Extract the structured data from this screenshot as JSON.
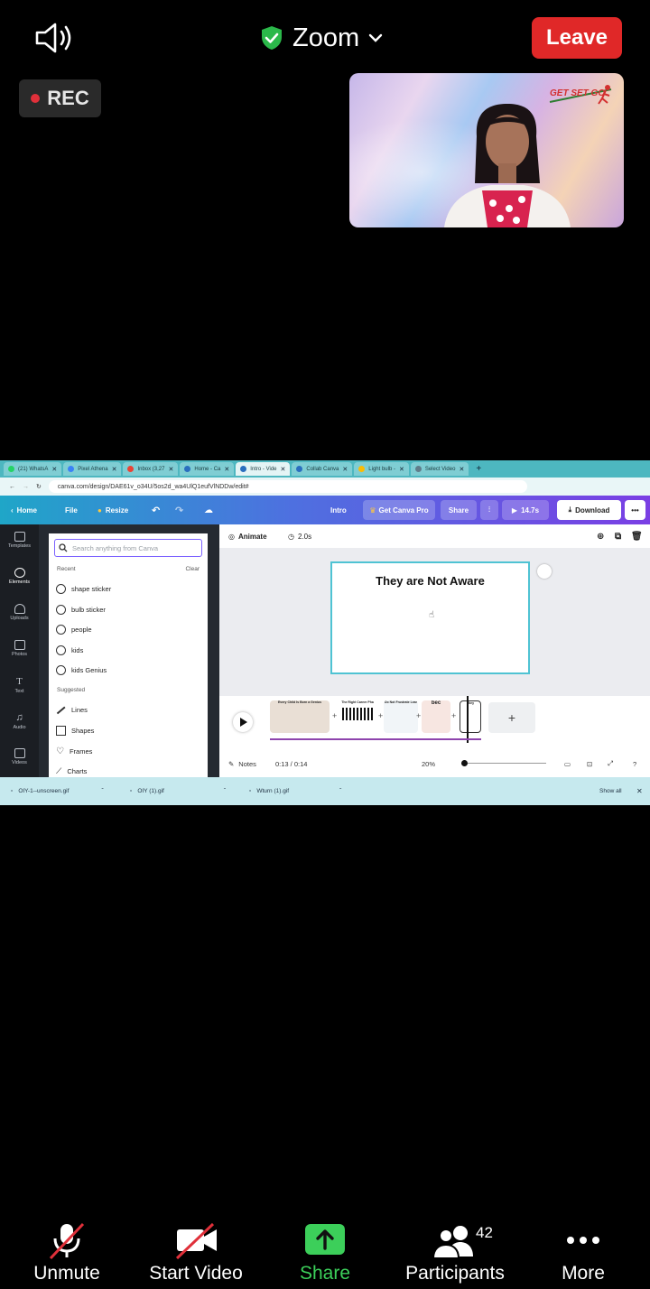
{
  "topbar": {
    "title": "Zoom",
    "leave_label": "Leave",
    "rec_label": "REC",
    "accent_leave": "#e02828",
    "shield_color": "#2bb84a"
  },
  "participant_video": {
    "logo_text": "GET SET GO"
  },
  "shared_screen": {
    "browser_tabs": [
      "(21) WhatsA",
      "Pixel Athena",
      "Inbox (3,27",
      "Home - Ca",
      "Intro - Vide",
      "Collab Canva",
      "Light bulb -",
      "Select Video"
    ],
    "url": "canva.com/design/DAE61v_o34U/5os2d_wa4UlQ1eufVlNDDw/edit#",
    "canva_bar": {
      "home": "Home",
      "file": "File",
      "resize": "Resize",
      "project_name": "Intro",
      "get_pro": "Get Canva Pro",
      "share": "Share",
      "duration": "14.7s",
      "download": "Download"
    },
    "left_rail": [
      "Templates",
      "Elements",
      "Uploads",
      "Photos",
      "Text",
      "Audio",
      "Videos"
    ],
    "panel": {
      "search_placeholder": "Search anything from Canva",
      "recent_label": "Recent",
      "clear_label": "Clear",
      "recent_items": [
        "shape sticker",
        "bulb sticker",
        "people",
        "kids",
        "kids Genius"
      ],
      "suggested_label": "Suggested",
      "suggested_items": [
        "Lines",
        "Shapes",
        "Frames",
        "Charts"
      ]
    },
    "editor": {
      "animate_label": "Animate",
      "slide_duration": "2.0s",
      "slide_heading": "They are Not Aware",
      "clip_titles": [
        "Every Child Is Born a Genius",
        "The Right Career Pha",
        "Do Not Frustrate Lear",
        "bec",
        "They"
      ],
      "notes_label": "Notes",
      "time": "0:13 / 0:14",
      "zoom": "20%"
    },
    "downloads": {
      "files": [
        "OIY-1--unscreen.gif",
        "OIY (1).gif",
        "Wturn (1).gif"
      ],
      "show_all": "Show all"
    }
  },
  "toolbar": {
    "unmute": "Unmute",
    "start_video": "Start Video",
    "share": "Share",
    "participants": "Participants",
    "participant_count": "42",
    "more": "More",
    "share_color": "#3ccf5a"
  }
}
